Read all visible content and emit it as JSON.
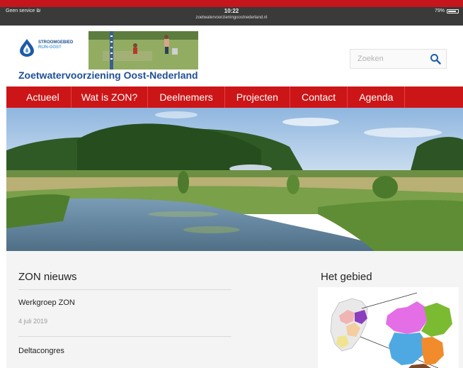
{
  "status_bar": {
    "carrier": "Geen service",
    "time": "10:22",
    "url": "zoetwatervoorzieningoostnederland.nl",
    "battery": "79%"
  },
  "header": {
    "logo_line1": "STROOMGEBIED",
    "logo_line2": "RIJN-OOST",
    "site_title": "Zoetwatervoorziening Oost-Nederland",
    "search_placeholder": "Zoeken"
  },
  "nav": {
    "items": [
      {
        "label": "Actueel"
      },
      {
        "label": "Wat is ZON?"
      },
      {
        "label": "Deelnemers"
      },
      {
        "label": "Projecten"
      },
      {
        "label": "Contact"
      },
      {
        "label": "Agenda"
      }
    ]
  },
  "news": {
    "heading": "ZON nieuws",
    "items": [
      {
        "title": "Werkgroep ZON",
        "date": "4 juli 2019"
      },
      {
        "title": "Deltacongres",
        "date": ""
      }
    ]
  },
  "region": {
    "heading": "Het gebied"
  },
  "colors": {
    "brand_red": "#cc1517",
    "brand_blue": "#1f5096"
  },
  "icons": {
    "search": "search-icon",
    "logo": "water-drop-icon",
    "wifi": "wifi-icon",
    "battery": "battery-icon"
  }
}
